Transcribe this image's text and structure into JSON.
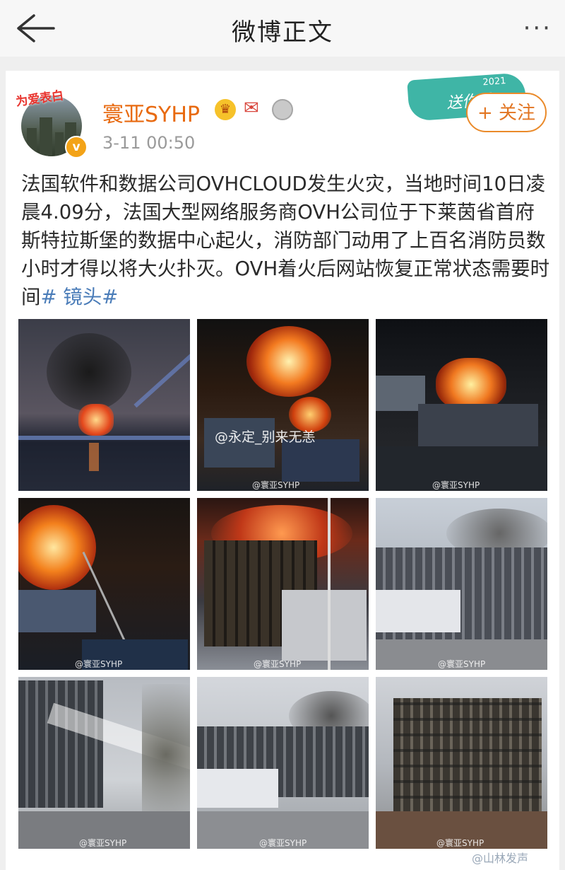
{
  "header": {
    "title": "微博正文",
    "back_icon": "arrow-left-icon",
    "more_label": "···"
  },
  "post": {
    "avatar_badge": "为爱表白",
    "verified_mark": "v",
    "username": "寰亚SYHP",
    "timestamp": "3-11 00:50",
    "follow_label": "+ 关注",
    "banner_year": "2021",
    "banner_text": "送你朵",
    "text_main": "法国软件和数据公司OVHCLOUD发生火灾，当地时间10日凌晨4.09分，法国大型网络服务商OVH公司位于下莱茵省首府斯特拉斯堡的数据中心起火，消防部门动用了上百名消防员数小时才得以将大火扑灭。OVH着火后网站恢复正常状态需要时间",
    "hashtag": "# 镜头#"
  },
  "images": {
    "watermark": "@寰亚SYHP",
    "overlay_watermark": "@永定_别来无恙",
    "footer_watermark": "@山林发声"
  },
  "colors": {
    "username": "#e86a10",
    "follow": "#e27522",
    "hashtag": "#4a7cb8"
  }
}
